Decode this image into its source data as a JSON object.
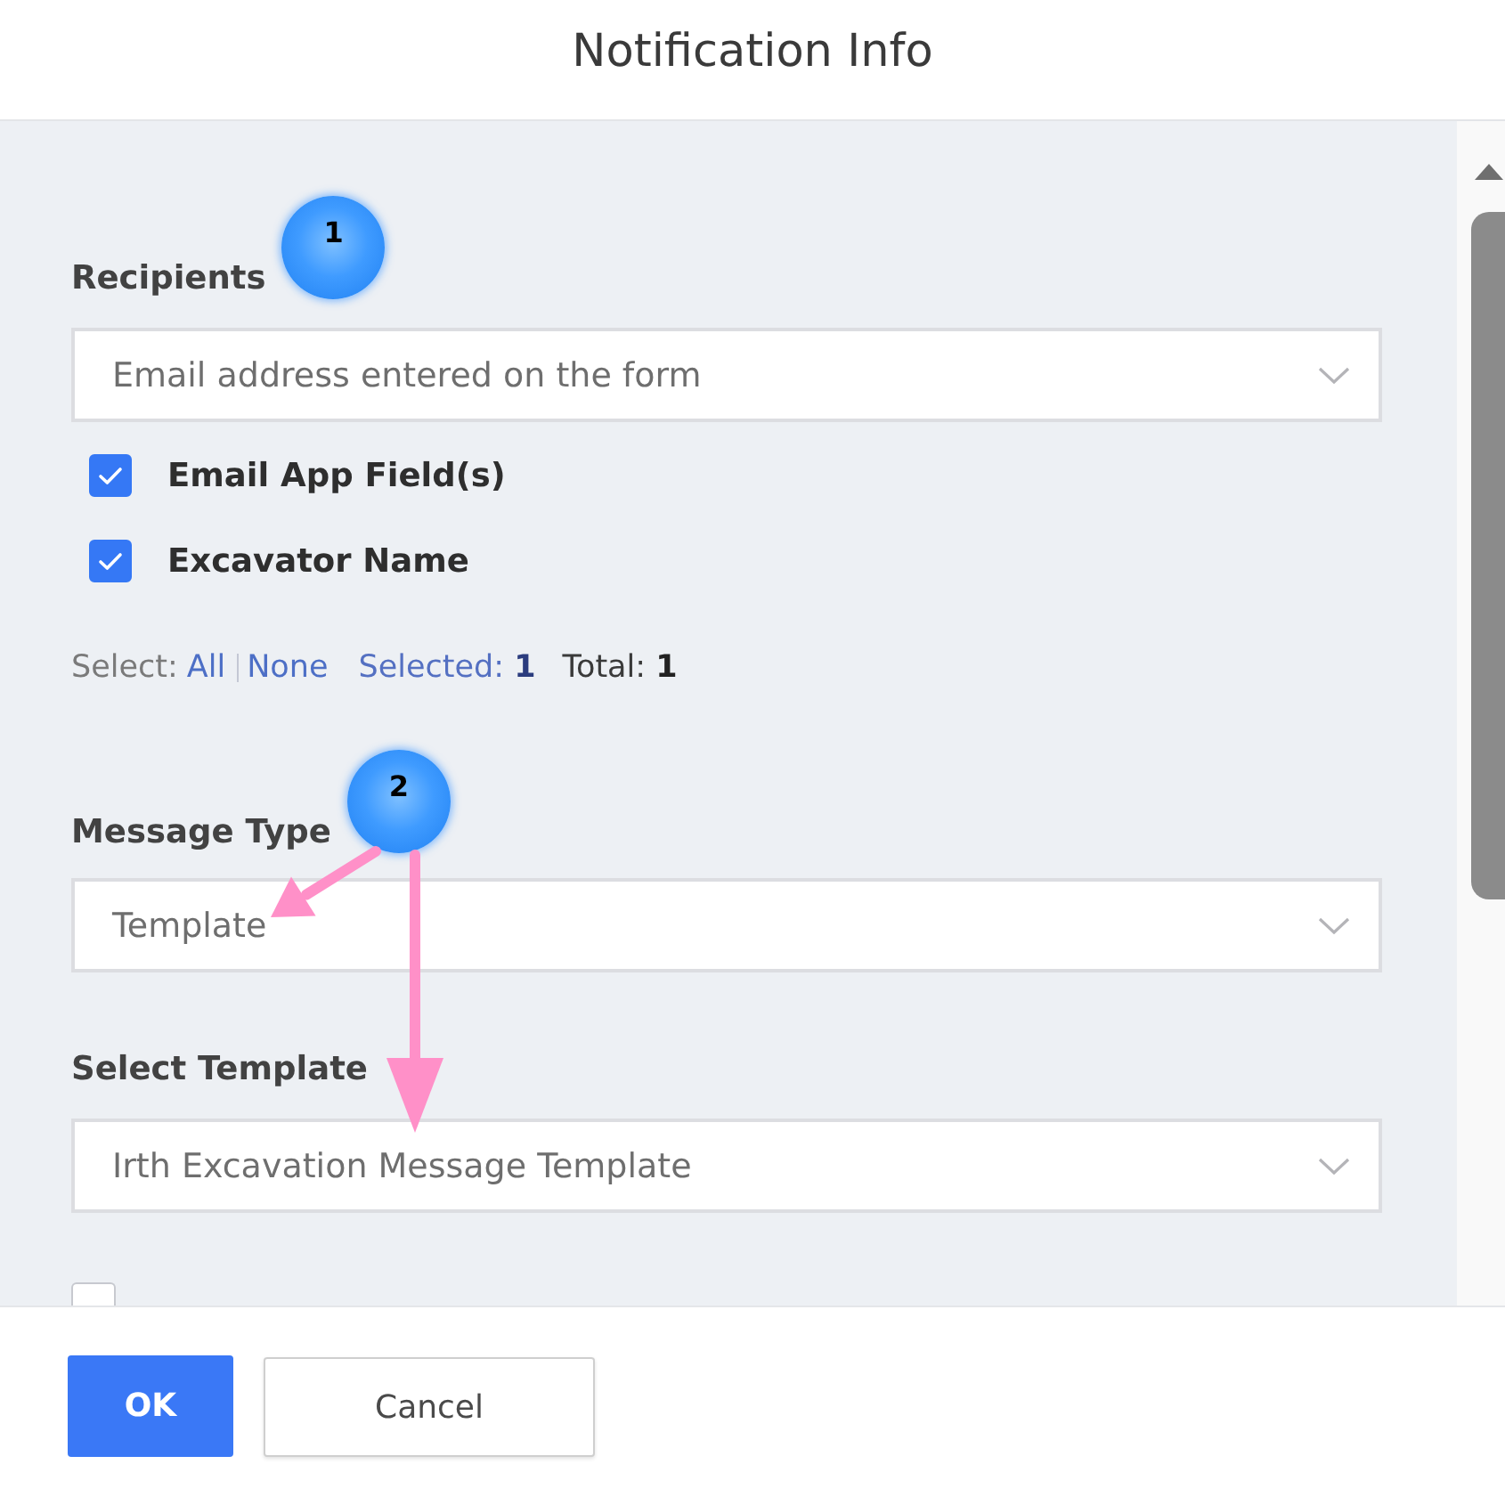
{
  "dialog": {
    "title": "Notification Info"
  },
  "recipients": {
    "label": "Recipients",
    "annotation": {
      "number": "1"
    },
    "dropdown": {
      "value": "Email address entered on the form"
    },
    "checkboxes": [
      {
        "label": "Email App Field(s)",
        "checked": true
      },
      {
        "label": "Excavator Name",
        "checked": true
      }
    ],
    "selection": {
      "prefix": "Select:",
      "links": [
        "All",
        "None"
      ],
      "selected": "Selected: **1**",
      "total": "Total: **1**"
    }
  },
  "message_type": {
    "label": "Message Type",
    "annotation": {
      "number": "2",
      "arrows": true
    },
    "dropdown": {
      "value": "Template"
    }
  },
  "select_template": {
    "label": "Select Template",
    "dropdown": {
      "value": "Irth Excavation Message Template"
    }
  },
  "partial_checkbox": {
    "checked": false
  },
  "buttons": [
    {
      "label": "OK",
      "kind": "primary"
    },
    {
      "label": "Cancel",
      "kind": "secondary"
    }
  ]
}
